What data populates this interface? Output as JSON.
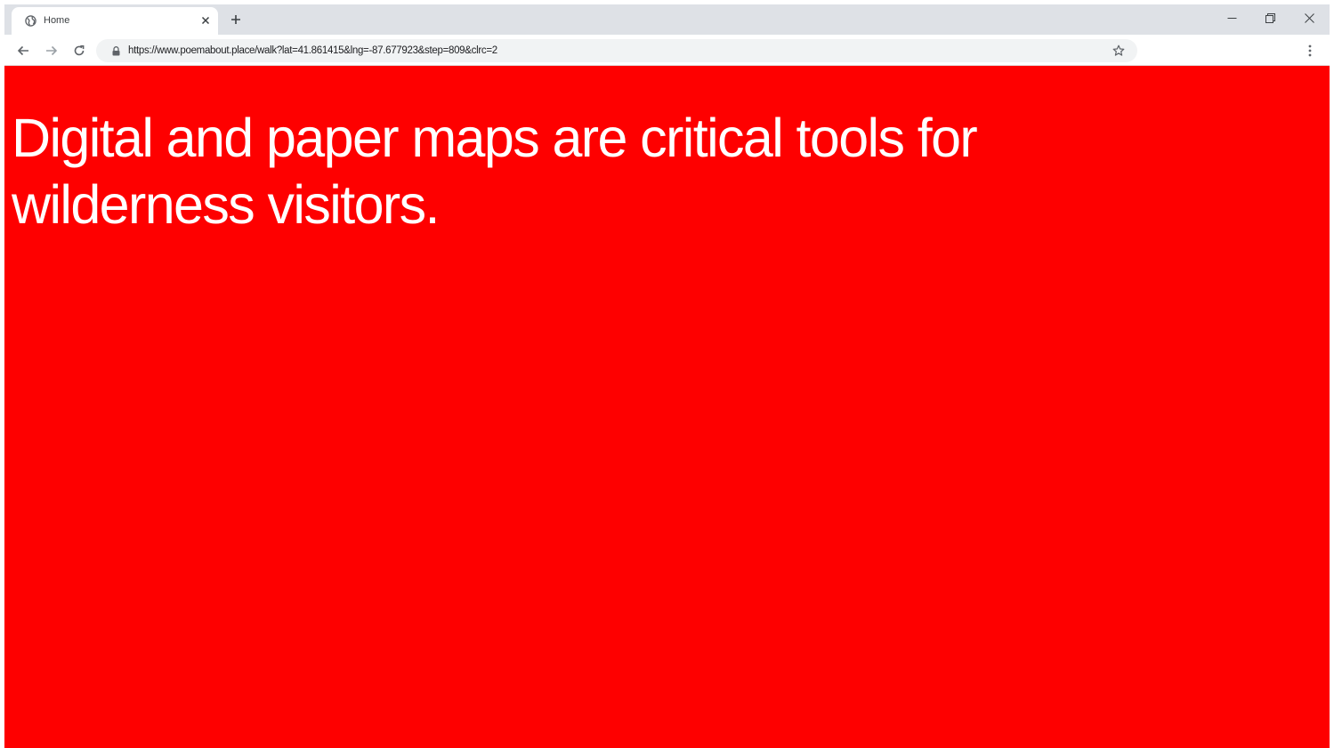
{
  "browser": {
    "tab": {
      "title": "Home",
      "favicon": "globe-icon",
      "close_icon": "close-icon"
    },
    "new_tab_icon": "plus-icon",
    "window_controls": {
      "minimize_icon": "minimize-icon",
      "maximize_icon": "restore-icon",
      "close_icon": "close-icon"
    },
    "toolbar": {
      "back_icon": "arrow-left-icon",
      "forward_icon": "arrow-right-icon",
      "reload_icon": "reload-icon",
      "lock_icon": "lock-icon",
      "url": "https://www.poemabout.place/walk?lat=41.861415&lng=-87.677923&step=809&clrc=2",
      "bookmark_icon": "star-icon",
      "menu_icon": "more-vertical-icon"
    }
  },
  "page": {
    "background_color": "#fe0000",
    "text_color": "#ffffff",
    "headline": "Digital and paper maps are critical tools for wilderness visitors."
  }
}
